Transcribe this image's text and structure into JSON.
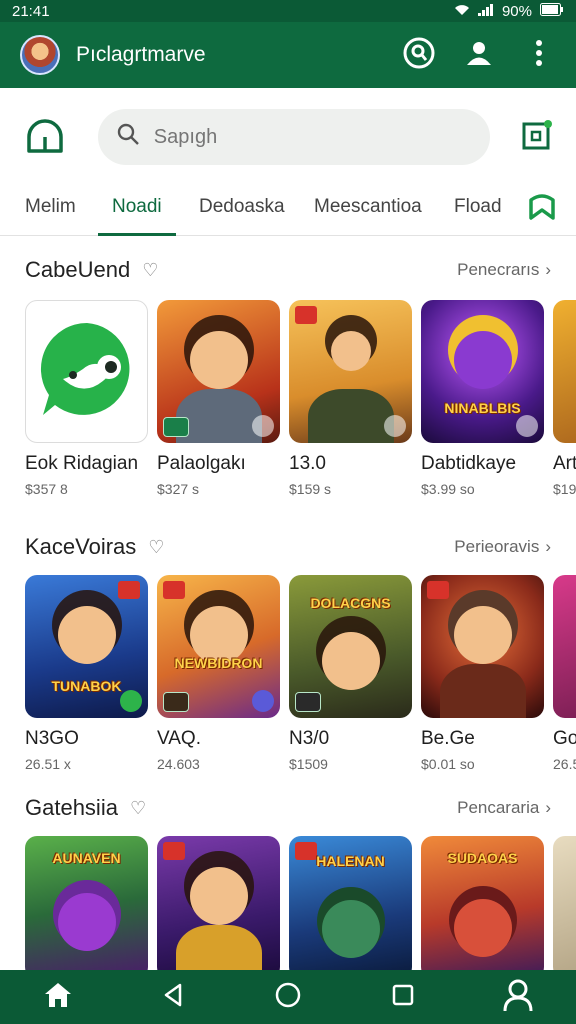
{
  "status_bar": {
    "time": "21:41",
    "battery": "90%"
  },
  "app_bar": {
    "title": "Pıclagrtmarve"
  },
  "search": {
    "placeholder": "Sapıgh"
  },
  "tabs": [
    {
      "label": "Melim",
      "active": false
    },
    {
      "label": "Noadi",
      "active": true
    },
    {
      "label": "Dedoaska",
      "active": false
    },
    {
      "label": "Meescantioa",
      "active": false
    },
    {
      "label": "Fload",
      "active": false
    }
  ],
  "sections": [
    {
      "title": "CabeUend",
      "more_label": "Penecrarıs",
      "items": [
        {
          "title": "Eok Ridagian",
          "subtitle": "$357 8",
          "bg": "#ffffff",
          "kind": "app-icon"
        },
        {
          "title": "Palaolgakı",
          "subtitle": "$327 s",
          "bg": "#d9641f",
          "kind": "hero"
        },
        {
          "title": "13.0",
          "subtitle": "$159 s",
          "bg": "#e9a43b",
          "kind": "hero"
        },
        {
          "title": "Dabtidkaye",
          "subtitle": "$3.99 so",
          "bg": "#5b2a8f",
          "kind": "logo",
          "logo": "NINABLBIS"
        },
        {
          "title": "Art",
          "subtitle": "$19",
          "bg": "#e0a12b",
          "kind": "hero"
        }
      ]
    },
    {
      "title": "KaceVoiras",
      "more_label": "Perieoravis",
      "items": [
        {
          "title": "N3GO",
          "subtitle": "26.51 x",
          "bg": "#2a5fb5",
          "kind": "logo",
          "logo": "TUNABOK"
        },
        {
          "title": "VAQ.",
          "subtitle": "24.603",
          "bg": "#e3903a",
          "kind": "logo",
          "logo": "NEWBIDRON"
        },
        {
          "title": "N3/0",
          "subtitle": "$1509",
          "bg": "#5b6b2a",
          "kind": "logo",
          "logo": "DOLACGNS"
        },
        {
          "title": "Be.Ge",
          "subtitle": "$0.01 so",
          "bg": "#8a2b1a",
          "kind": "hero"
        },
        {
          "title": "Go",
          "subtitle": "26.5",
          "bg": "#a3245e",
          "kind": "hero"
        }
      ]
    },
    {
      "title": "Gatehsiia",
      "more_label": "Pencararia",
      "items": [
        {
          "title": "",
          "subtitle": "",
          "bg": "#2f7a4a",
          "kind": "logo",
          "logo": "AUNAVEN"
        },
        {
          "title": "",
          "subtitle": "",
          "bg": "#6a2a8a",
          "kind": "hero"
        },
        {
          "title": "",
          "subtitle": "",
          "bg": "#1c4f8f",
          "kind": "logo",
          "logo": "HALENAN"
        },
        {
          "title": "",
          "subtitle": "",
          "bg": "#c8502a",
          "kind": "logo",
          "logo": "SUDAOAS"
        },
        {
          "title": "",
          "subtitle": "",
          "bg": "#d7c8a8",
          "kind": "hero"
        }
      ]
    }
  ],
  "colors": {
    "primary": "#0e6a3f",
    "status": "#0b5a36"
  },
  "icons": [
    "search-icon",
    "account-search-icon",
    "person-icon",
    "more-vert-icon",
    "cloud-icon",
    "qr-icon",
    "bookmark-icon",
    "home-icon",
    "back-icon",
    "circle-home-icon",
    "square-icon",
    "profile-icon"
  ]
}
